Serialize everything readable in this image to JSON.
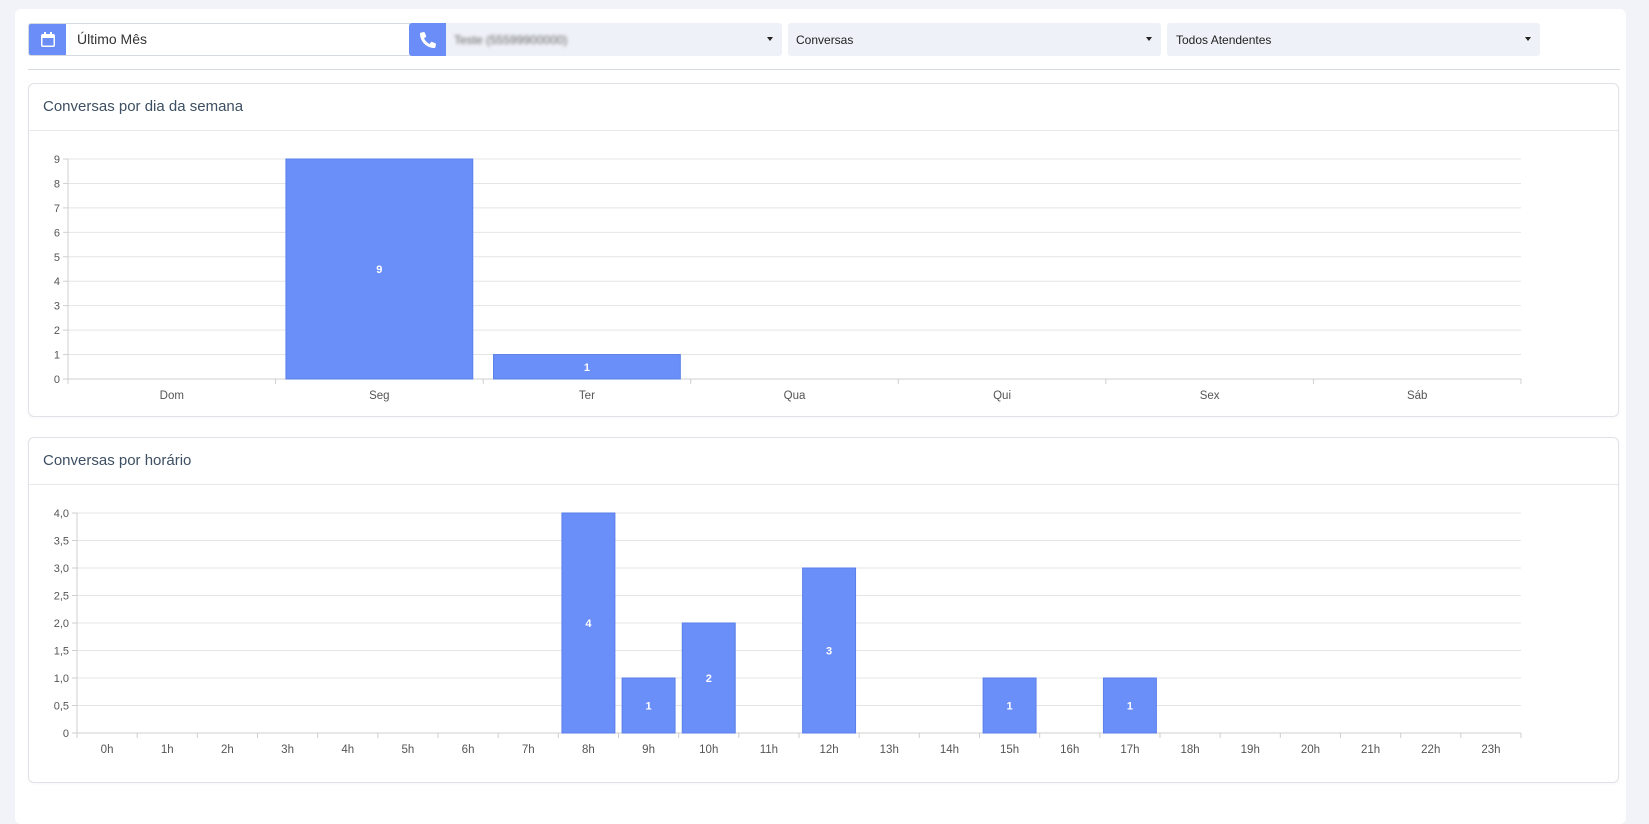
{
  "filters": {
    "date": {
      "value": "Último Mês",
      "icon": "calendar-icon"
    },
    "phone": {
      "value": "Teste (55599900000)",
      "icon": "phone-icon"
    },
    "type": {
      "value": "Conversas"
    },
    "agent": {
      "value": "Todos Atendentes"
    }
  },
  "colors": {
    "accent": "#6b8df7",
    "bar": "#6b8ff9",
    "bar_border": "#5a7fe9"
  },
  "charts": {
    "weekday": {
      "title": "Conversas por dia da semana"
    },
    "hourly": {
      "title": "Conversas por horário"
    }
  },
  "chart_data": [
    {
      "type": "bar",
      "title": "Conversas por dia da semana",
      "categories": [
        "Dom",
        "Seg",
        "Ter",
        "Qua",
        "Qui",
        "Sex",
        "Sáb"
      ],
      "values": [
        0,
        9,
        1,
        0,
        0,
        0,
        0
      ],
      "ylim": [
        0,
        9
      ],
      "yticks": [
        "0",
        "1",
        "2",
        "3",
        "4",
        "5",
        "6",
        "7",
        "8",
        "9"
      ],
      "grid": true,
      "data_labels": true
    },
    {
      "type": "bar",
      "title": "Conversas por horário",
      "categories": [
        "0h",
        "1h",
        "2h",
        "3h",
        "4h",
        "5h",
        "6h",
        "7h",
        "8h",
        "9h",
        "10h",
        "11h",
        "12h",
        "13h",
        "14h",
        "15h",
        "16h",
        "17h",
        "18h",
        "19h",
        "20h",
        "21h",
        "22h",
        "23h"
      ],
      "values": [
        0,
        0,
        0,
        0,
        0,
        0,
        0,
        0,
        4,
        1,
        2,
        0,
        3,
        0,
        0,
        1,
        0,
        1,
        0,
        0,
        0,
        0,
        0,
        0
      ],
      "ylim": [
        0,
        4
      ],
      "yticks": [
        "0",
        "0,5",
        "1,0",
        "1,5",
        "2,0",
        "2,5",
        "3,0",
        "3,5",
        "4,0"
      ],
      "grid": true,
      "data_labels": true
    }
  ]
}
